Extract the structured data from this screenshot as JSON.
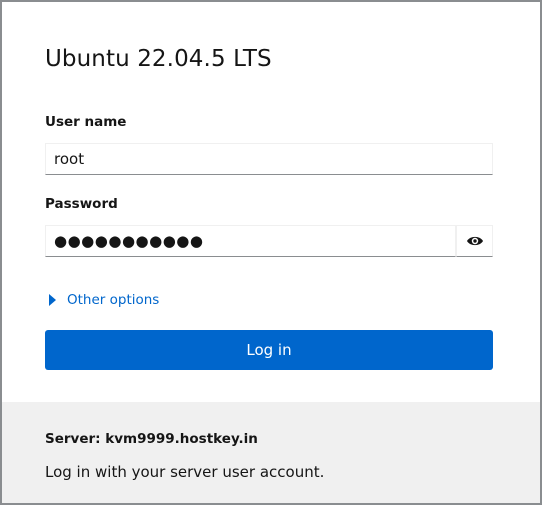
{
  "login": {
    "title": "Ubuntu 22.04.5 LTS",
    "username_label": "User name",
    "username_value": "root",
    "password_label": "Password",
    "password_value": "●●●●●●●●●●●",
    "show_password_icon": "eye-icon",
    "other_options_label": "Other options",
    "login_button_label": "Log in"
  },
  "footer": {
    "server_text": "Server: kvm9999.hostkey.in",
    "hint_text": "Log in with your server user account."
  },
  "colors": {
    "accent": "#0066cc",
    "footer_bg": "#f0f0f0",
    "text": "#151515"
  }
}
